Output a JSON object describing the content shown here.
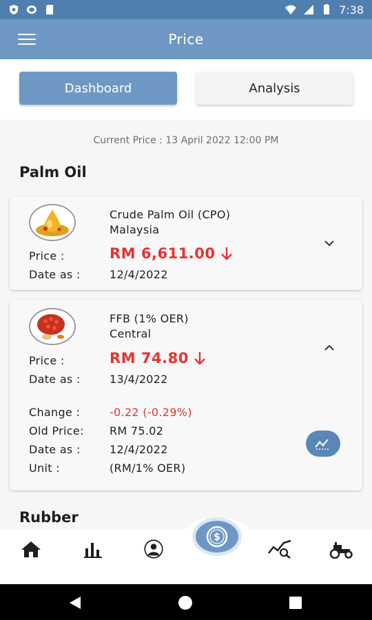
{
  "status_bar": {
    "time": "7:38",
    "icons": [
      "shield-icon",
      "cast-icon",
      "sd-card-icon",
      "wifi-icon",
      "signal-icon",
      "battery-icon"
    ]
  },
  "app_bar": {
    "title": "Price",
    "menu_icon": "hamburger-icon"
  },
  "tabs": {
    "dashboard": "Dashboard",
    "analysis": "Analysis",
    "active": "dashboard"
  },
  "current_price": "Current Price : 13 April 2022  12:00 PM",
  "sections": {
    "palm_oil": "Palm Oil",
    "rubber": "Rubber"
  },
  "cards": {
    "cpo": {
      "name_line1": "Crude Palm Oil (CPO)",
      "name_line2": "Malaysia",
      "price_label": "Price :",
      "price": "RM 6,611.00",
      "date_label": "Date as :",
      "date": "12/4/2022",
      "trend": "down",
      "expanded": false
    },
    "ffb": {
      "name_line1": "FFB (1% OER)",
      "name_line2": "Central",
      "price_label": "Price :",
      "price": "RM 74.80",
      "date_label": "Date as :",
      "date": "13/4/2022",
      "change_label": "Change :",
      "change": "-0.22  (-0.29%)",
      "old_price_label": "Old Price:",
      "old_price": "RM 75.02",
      "old_date_label": "Date as :",
      "old_date": "12/4/2022",
      "unit_label": "Unit :",
      "unit": "(RM/1% OER)",
      "trend": "down",
      "expanded": true
    }
  },
  "bottom_nav": [
    "home-icon",
    "bar-chart-icon",
    "profile-icon",
    "price-dollar-icon",
    "analysis-search-icon",
    "tractor-icon"
  ],
  "colors": {
    "primary": "#6e98c3",
    "status": "#4f7fae",
    "down": "#e83232"
  }
}
